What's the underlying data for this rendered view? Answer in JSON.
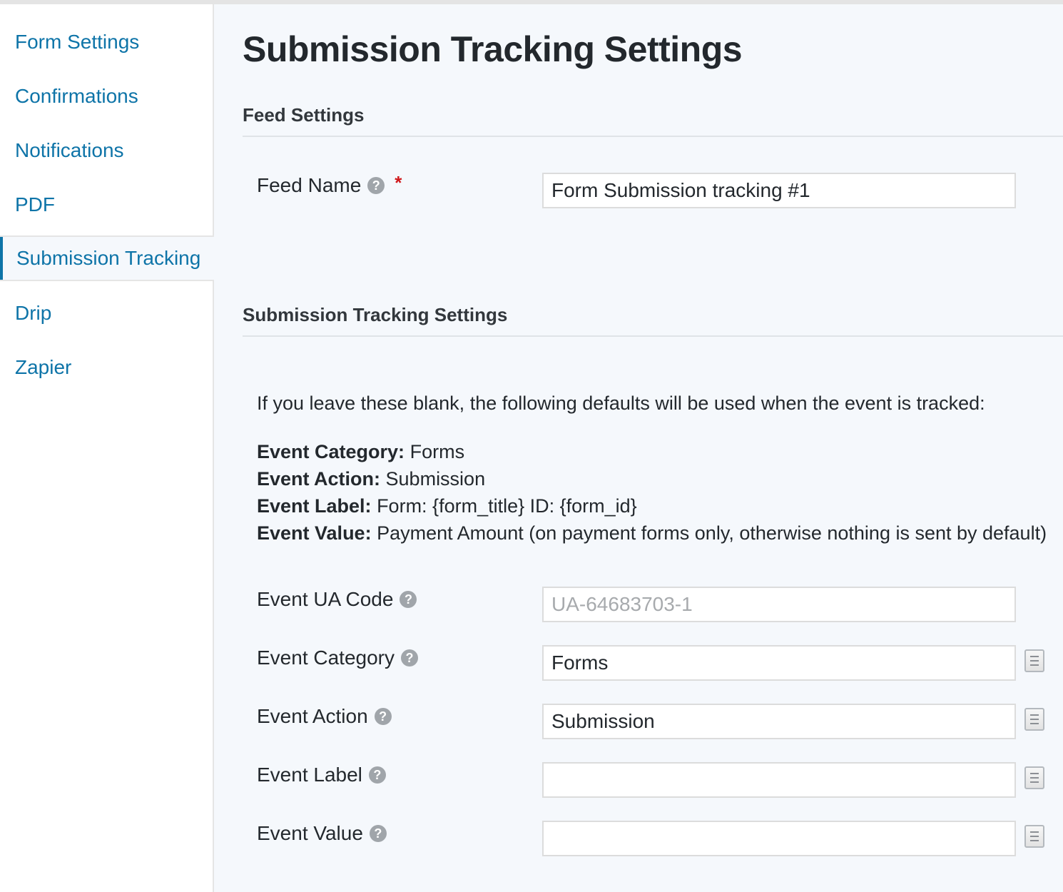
{
  "sidebar": {
    "items": [
      {
        "label": "Form Settings"
      },
      {
        "label": "Confirmations"
      },
      {
        "label": "Notifications"
      },
      {
        "label": "PDF"
      },
      {
        "label": "Submission Tracking",
        "active": true
      },
      {
        "label": "Drip"
      },
      {
        "label": "Zapier"
      }
    ]
  },
  "page": {
    "title": "Submission Tracking Settings"
  },
  "feed_settings": {
    "title": "Feed Settings",
    "feed_name": {
      "label": "Feed Name",
      "required_mark": "*",
      "value": "Form Submission tracking #1"
    }
  },
  "tracking_settings": {
    "title": "Submission Tracking Settings",
    "intro": "If you leave these blank, the following defaults will be used when the event is tracked:",
    "defaults": [
      {
        "key": "Event Category:",
        "value": "Forms"
      },
      {
        "key": "Event Action:",
        "value": "Submission"
      },
      {
        "key": "Event Label:",
        "value": "Form: {form_title} ID: {form_id}"
      },
      {
        "key": "Event Value:",
        "value": "Payment Amount (on payment forms only, otherwise nothing is sent by default)"
      }
    ],
    "fields": {
      "ua_code": {
        "label": "Event UA Code",
        "value": "",
        "placeholder": "UA-64683703-1"
      },
      "category": {
        "label": "Event Category",
        "value": "Forms"
      },
      "action": {
        "label": "Event Action",
        "value": "Submission"
      },
      "label": {
        "label": "Event Label",
        "value": ""
      },
      "event_value": {
        "label": "Event Value",
        "value": ""
      }
    }
  },
  "icons": {
    "help": "help-circle-icon",
    "merge_tag": "merge-tag-icon"
  },
  "colors": {
    "link": "#0e74a8",
    "required": "#d0181b",
    "background": "#f5f8fc"
  }
}
